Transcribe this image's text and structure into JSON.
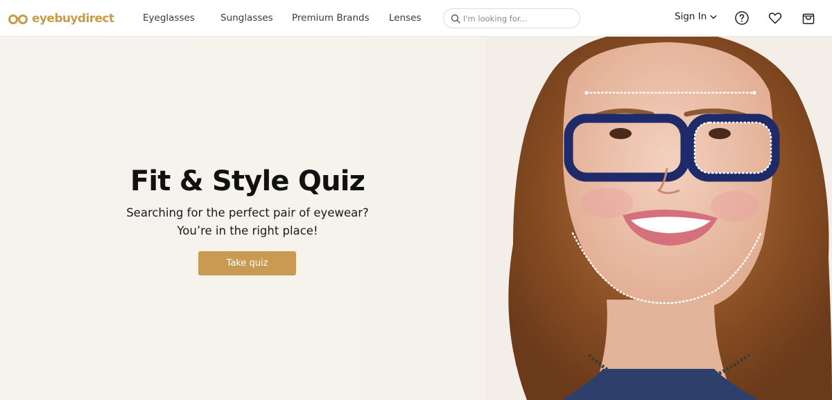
{
  "header": {
    "logo_text": "eyebuydirect",
    "nav": {
      "eyeglasses": "Eyeglasses",
      "sunglasses": "Sunglasses",
      "premium_brands": "Premium Brands",
      "lenses": "Lenses"
    },
    "search": {
      "placeholder": "I'm looking for...",
      "value": "",
      "icon": "search-icon"
    },
    "sign_in": "Sign In",
    "icons": {
      "help": "help-circle-icon",
      "wishlist": "heart-icon",
      "cart": "shopping-bag-icon"
    }
  },
  "hero": {
    "title": "Fit & Style Quiz",
    "subtitle_line1": "Searching for the perfect pair of eyewear?",
    "subtitle_line2": "You’re in the right place!",
    "cta": "Take quiz"
  },
  "colors": {
    "brand": "#c99c4a",
    "cta_background": "#c99a52",
    "hero_background": "#f6f2ec",
    "frame_navy": "#1f2a6b"
  }
}
